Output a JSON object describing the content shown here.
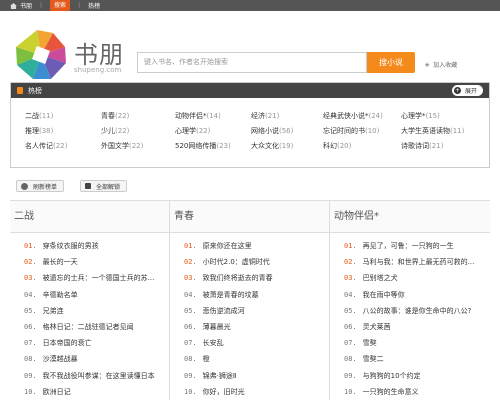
{
  "topbar": {
    "home": "书朋",
    "active": "搜索",
    "hot": "热榜"
  },
  "header": {
    "brand": "书朋",
    "brand_sub": "shupeng.com",
    "search_placeholder": "键入书名、作者名开始搜索",
    "search_button": "搜小说",
    "favorite": "加入收藏"
  },
  "hot_panel": {
    "title": "热榜",
    "expand": "展开",
    "rows": [
      [
        {
          "name": "二战",
          "count": "(11)"
        },
        {
          "name": "青春",
          "count": "(22)"
        },
        {
          "name": "动物伴侣*",
          "count": "(14)"
        },
        {
          "name": "经济",
          "count": "(21)"
        },
        {
          "name": "经典武侠小说*",
          "count": "(24)"
        },
        {
          "name": "心理学*",
          "count": "(15)"
        }
      ],
      [
        {
          "name": "推理",
          "count": "(38)"
        },
        {
          "name": "少儿",
          "count": "(22)"
        },
        {
          "name": "心理学",
          "count": "(22)"
        },
        {
          "name": "网络小说",
          "count": "(56)"
        },
        {
          "name": "忘记时间的书",
          "count": "(10)"
        },
        {
          "name": "大学生英语读物",
          "count": "(11)"
        }
      ],
      [
        {
          "name": "名人传记",
          "count": "(22)"
        },
        {
          "name": "外国文学",
          "count": "(22)"
        },
        {
          "name": "520网络传播",
          "count": "(23)"
        },
        {
          "name": "大众文化",
          "count": "(19)"
        },
        {
          "name": "科幻",
          "count": "(20)"
        },
        {
          "name": "诗歌诗词",
          "count": "(21)"
        }
      ]
    ]
  },
  "buttons": {
    "refresh": "刷新榜单",
    "unlock": "全部解锁"
  },
  "columns": [
    {
      "title": "二战",
      "items": [
        "穿条纹衣服的男孩",
        "最长的一天",
        "被遗忘的士兵：一个德国士兵的苏...",
        "辛德勒名单",
        "兄弟连",
        "格林日记：二战驻德记者见闻",
        "日本帝国的衰亡",
        "沙漠越战暴",
        "我不我战役叫参谋：在这里读懂日本",
        "欧洲日记"
      ]
    },
    {
      "title": "青春",
      "items": [
        "原来你还在这里",
        "小时代2.0：虚铜时代",
        "致我们终将逝去的青春",
        "被萧是青春的坟墓",
        "悲伤逆流成河",
        "薄暮晨光",
        "长安乱",
        "橙",
        "锦弗·狮途Ⅱ",
        "你好，旧时光"
      ]
    },
    {
      "title": "动物伴侣*",
      "items": [
        "再见了，可鲁：一只狗的一生",
        "马利与我：和世界上最无药可救的...",
        "巴别塔之犬",
        "我在雨中等你",
        "八公的故事：谁是你生命中的八公?",
        "灵犬莱茜",
        "雪獒",
        "雪獒二",
        "与狗狗的10个约定",
        "一只狗的生命意义"
      ]
    }
  ],
  "colors": {
    "accent": "#f58a1c",
    "rank_highlight": "#e55a1c",
    "topbar_bg": "#555555"
  }
}
